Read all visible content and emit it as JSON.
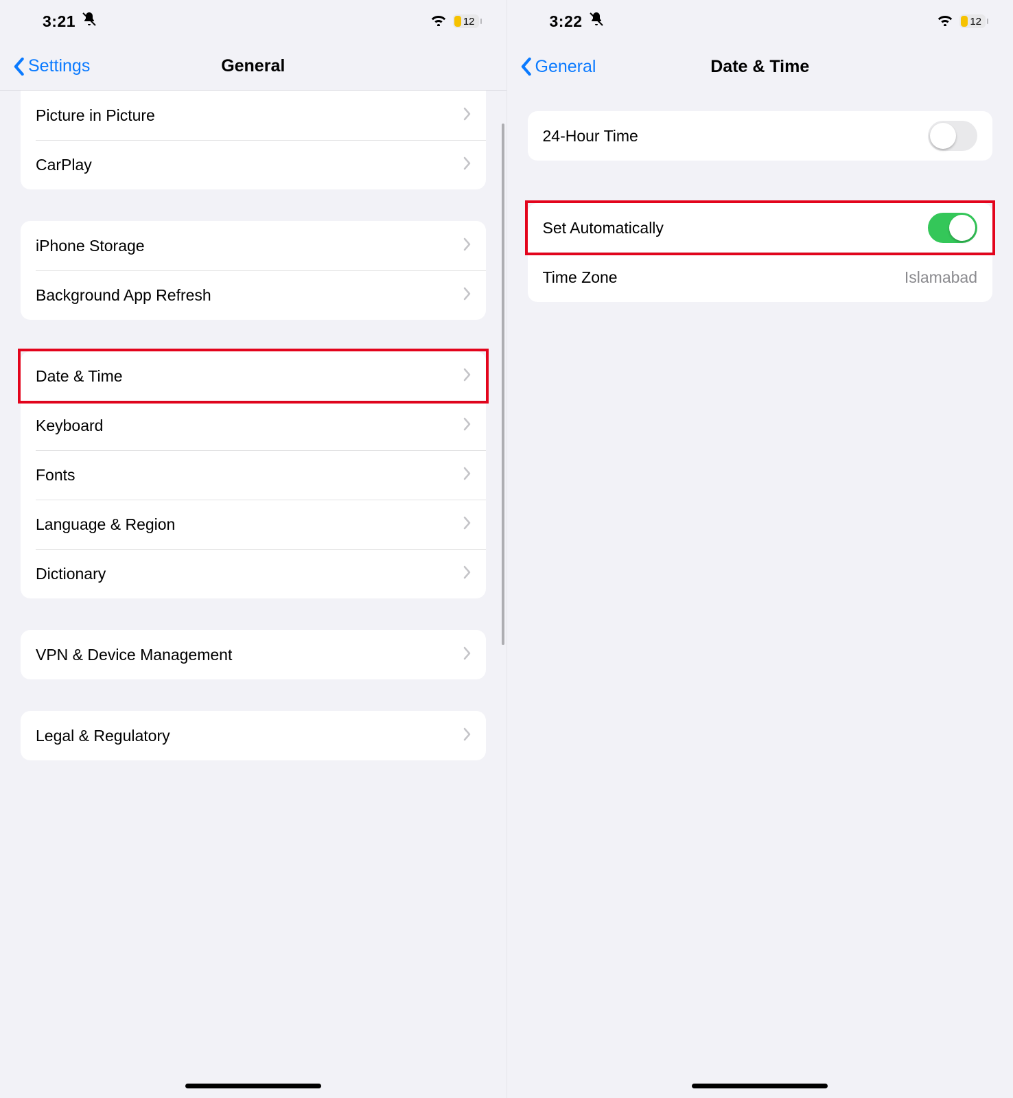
{
  "left": {
    "status": {
      "time": "3:21",
      "battery": "12"
    },
    "nav": {
      "back": "Settings",
      "title": "General"
    },
    "groups": [
      {
        "first": true,
        "rows": [
          {
            "label": "Picture in Picture"
          },
          {
            "label": "CarPlay"
          }
        ]
      },
      {
        "rows": [
          {
            "label": "iPhone Storage"
          },
          {
            "label": "Background App Refresh"
          }
        ]
      },
      {
        "rows": [
          {
            "label": "Date & Time",
            "highlight": true
          },
          {
            "label": "Keyboard"
          },
          {
            "label": "Fonts"
          },
          {
            "label": "Language & Region"
          },
          {
            "label": "Dictionary"
          }
        ]
      },
      {
        "rows": [
          {
            "label": "VPN & Device Management"
          }
        ]
      },
      {
        "rows": [
          {
            "label": "Legal & Regulatory"
          }
        ]
      }
    ]
  },
  "right": {
    "status": {
      "time": "3:22",
      "battery": "12"
    },
    "nav": {
      "back": "General",
      "title": "Date & Time"
    },
    "rows": {
      "twentyfour": {
        "label": "24-Hour Time",
        "on": false
      },
      "auto": {
        "label": "Set Automatically",
        "on": true,
        "highlight": true
      },
      "tz": {
        "label": "Time Zone",
        "value": "Islamabad"
      }
    }
  }
}
